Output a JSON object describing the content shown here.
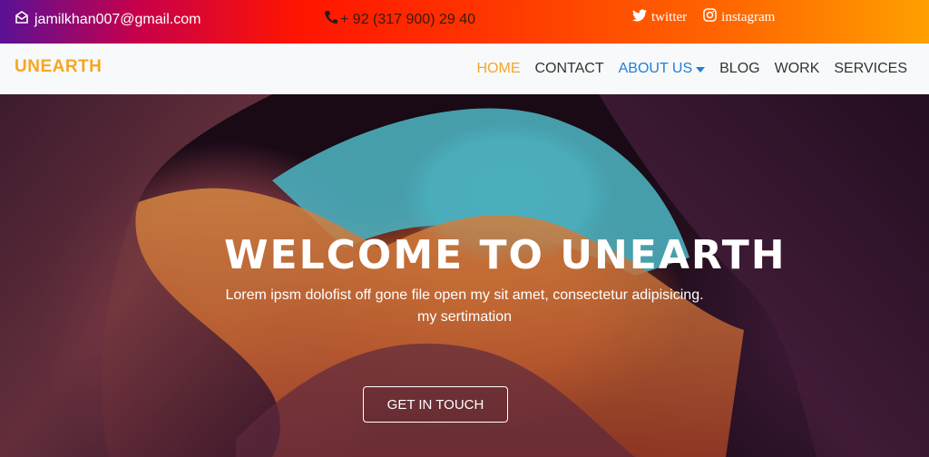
{
  "topbar": {
    "email": "jamilkhan007@gmail.com",
    "phone": "+ 92 (317 900) 29 40",
    "social": {
      "twitter": "twitter",
      "instagram": "instagram"
    },
    "gradient": [
      "#5a1196",
      "#ff1400",
      "#ffa000"
    ]
  },
  "navbar": {
    "brand": "UNEARTH",
    "items": [
      {
        "label": "HOME"
      },
      {
        "label": "CONTACT"
      },
      {
        "label": "ABOUT US"
      },
      {
        "label": "BLOG"
      },
      {
        "label": "WORK"
      },
      {
        "label": "SERVICES"
      }
    ],
    "accent": "#f6a623",
    "link_blue": "#1f7fd6"
  },
  "hero": {
    "title": "WELCOME TO UNEARTH",
    "subtitle": "Lorem ipsm dolofist off gone file open my sit amet, consectetur adipisicing. my sertimation",
    "cta": "GET IN TOUCH"
  }
}
